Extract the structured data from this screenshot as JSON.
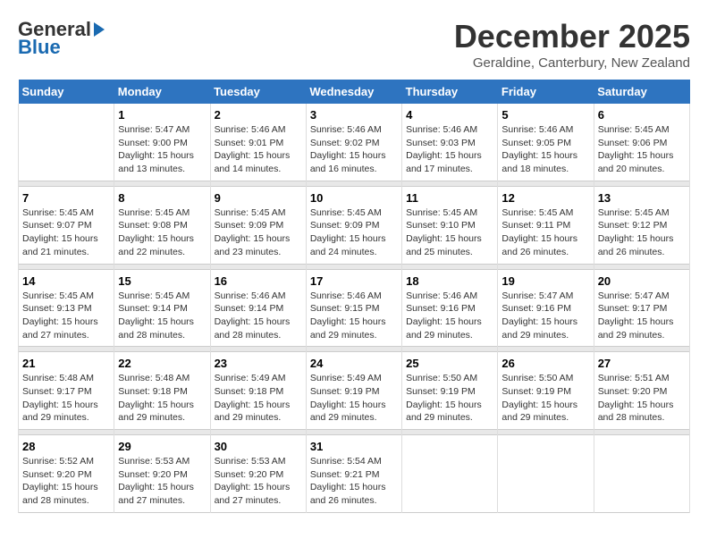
{
  "header": {
    "logo_general": "General",
    "logo_blue": "Blue",
    "title": "December 2025",
    "subtitle": "Geraldine, Canterbury, New Zealand"
  },
  "calendar": {
    "days_of_week": [
      "Sunday",
      "Monday",
      "Tuesday",
      "Wednesday",
      "Thursday",
      "Friday",
      "Saturday"
    ],
    "weeks": [
      [
        {
          "day": "",
          "info": ""
        },
        {
          "day": "1",
          "info": "Sunrise: 5:47 AM\nSunset: 9:00 PM\nDaylight: 15 hours\nand 13 minutes."
        },
        {
          "day": "2",
          "info": "Sunrise: 5:46 AM\nSunset: 9:01 PM\nDaylight: 15 hours\nand 14 minutes."
        },
        {
          "day": "3",
          "info": "Sunrise: 5:46 AM\nSunset: 9:02 PM\nDaylight: 15 hours\nand 16 minutes."
        },
        {
          "day": "4",
          "info": "Sunrise: 5:46 AM\nSunset: 9:03 PM\nDaylight: 15 hours\nand 17 minutes."
        },
        {
          "day": "5",
          "info": "Sunrise: 5:46 AM\nSunset: 9:05 PM\nDaylight: 15 hours\nand 18 minutes."
        },
        {
          "day": "6",
          "info": "Sunrise: 5:45 AM\nSunset: 9:06 PM\nDaylight: 15 hours\nand 20 minutes."
        }
      ],
      [
        {
          "day": "7",
          "info": "Sunrise: 5:45 AM\nSunset: 9:07 PM\nDaylight: 15 hours\nand 21 minutes."
        },
        {
          "day": "8",
          "info": "Sunrise: 5:45 AM\nSunset: 9:08 PM\nDaylight: 15 hours\nand 22 minutes."
        },
        {
          "day": "9",
          "info": "Sunrise: 5:45 AM\nSunset: 9:09 PM\nDaylight: 15 hours\nand 23 minutes."
        },
        {
          "day": "10",
          "info": "Sunrise: 5:45 AM\nSunset: 9:09 PM\nDaylight: 15 hours\nand 24 minutes."
        },
        {
          "day": "11",
          "info": "Sunrise: 5:45 AM\nSunset: 9:10 PM\nDaylight: 15 hours\nand 25 minutes."
        },
        {
          "day": "12",
          "info": "Sunrise: 5:45 AM\nSunset: 9:11 PM\nDaylight: 15 hours\nand 26 minutes."
        },
        {
          "day": "13",
          "info": "Sunrise: 5:45 AM\nSunset: 9:12 PM\nDaylight: 15 hours\nand 26 minutes."
        }
      ],
      [
        {
          "day": "14",
          "info": "Sunrise: 5:45 AM\nSunset: 9:13 PM\nDaylight: 15 hours\nand 27 minutes."
        },
        {
          "day": "15",
          "info": "Sunrise: 5:45 AM\nSunset: 9:14 PM\nDaylight: 15 hours\nand 28 minutes."
        },
        {
          "day": "16",
          "info": "Sunrise: 5:46 AM\nSunset: 9:14 PM\nDaylight: 15 hours\nand 28 minutes."
        },
        {
          "day": "17",
          "info": "Sunrise: 5:46 AM\nSunset: 9:15 PM\nDaylight: 15 hours\nand 29 minutes."
        },
        {
          "day": "18",
          "info": "Sunrise: 5:46 AM\nSunset: 9:16 PM\nDaylight: 15 hours\nand 29 minutes."
        },
        {
          "day": "19",
          "info": "Sunrise: 5:47 AM\nSunset: 9:16 PM\nDaylight: 15 hours\nand 29 minutes."
        },
        {
          "day": "20",
          "info": "Sunrise: 5:47 AM\nSunset: 9:17 PM\nDaylight: 15 hours\nand 29 minutes."
        }
      ],
      [
        {
          "day": "21",
          "info": "Sunrise: 5:48 AM\nSunset: 9:17 PM\nDaylight: 15 hours\nand 29 minutes."
        },
        {
          "day": "22",
          "info": "Sunrise: 5:48 AM\nSunset: 9:18 PM\nDaylight: 15 hours\nand 29 minutes."
        },
        {
          "day": "23",
          "info": "Sunrise: 5:49 AM\nSunset: 9:18 PM\nDaylight: 15 hours\nand 29 minutes."
        },
        {
          "day": "24",
          "info": "Sunrise: 5:49 AM\nSunset: 9:19 PM\nDaylight: 15 hours\nand 29 minutes."
        },
        {
          "day": "25",
          "info": "Sunrise: 5:50 AM\nSunset: 9:19 PM\nDaylight: 15 hours\nand 29 minutes."
        },
        {
          "day": "26",
          "info": "Sunrise: 5:50 AM\nSunset: 9:19 PM\nDaylight: 15 hours\nand 29 minutes."
        },
        {
          "day": "27",
          "info": "Sunrise: 5:51 AM\nSunset: 9:20 PM\nDaylight: 15 hours\nand 28 minutes."
        }
      ],
      [
        {
          "day": "28",
          "info": "Sunrise: 5:52 AM\nSunset: 9:20 PM\nDaylight: 15 hours\nand 28 minutes."
        },
        {
          "day": "29",
          "info": "Sunrise: 5:53 AM\nSunset: 9:20 PM\nDaylight: 15 hours\nand 27 minutes."
        },
        {
          "day": "30",
          "info": "Sunrise: 5:53 AM\nSunset: 9:20 PM\nDaylight: 15 hours\nand 27 minutes."
        },
        {
          "day": "31",
          "info": "Sunrise: 5:54 AM\nSunset: 9:21 PM\nDaylight: 15 hours\nand 26 minutes."
        },
        {
          "day": "",
          "info": ""
        },
        {
          "day": "",
          "info": ""
        },
        {
          "day": "",
          "info": ""
        }
      ]
    ]
  }
}
